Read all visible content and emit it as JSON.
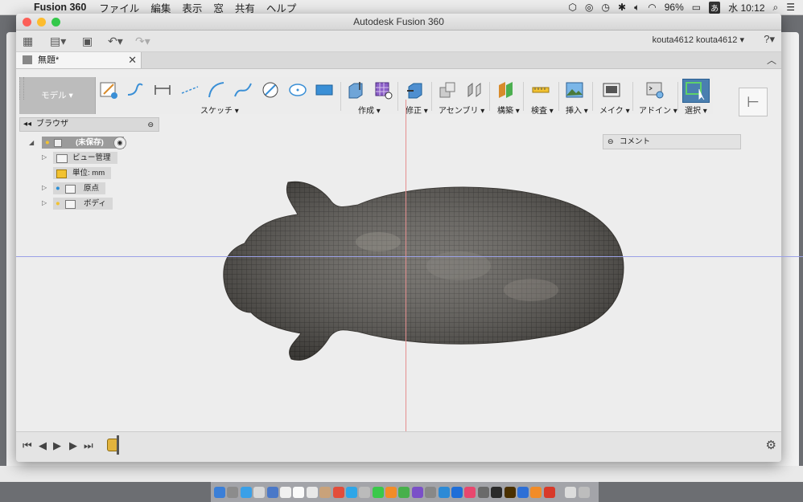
{
  "menubar": {
    "app_name": "Fusion 360",
    "items": [
      "ファイル",
      "編集",
      "表示",
      "窓",
      "共有",
      "ヘルプ"
    ],
    "battery": "96%",
    "input_mode": "あ",
    "clock": "水 10:12"
  },
  "window": {
    "title": "Autodesk Fusion 360",
    "user": "kouta4612 kouta4612",
    "doc_tab": "無題*"
  },
  "toolbar": {
    "workspace": "モデル",
    "groups": [
      {
        "label": "スケッチ"
      },
      {
        "label": "作成"
      },
      {
        "label": "修正"
      },
      {
        "label": "アセンブリ"
      },
      {
        "label": "構築"
      },
      {
        "label": "検査"
      },
      {
        "label": "挿入"
      },
      {
        "label": "メイク"
      },
      {
        "label": "アドイン"
      },
      {
        "label": "選択"
      }
    ]
  },
  "browser": {
    "title": "ブラウザ",
    "root": "(未保存)",
    "items": [
      "ビュー管理",
      "単位: mm",
      "原点",
      "ボディ"
    ]
  },
  "comment": {
    "label": "コメント"
  },
  "colors": {
    "accent": "#3a8fd6",
    "select_active": "#4a7fb0",
    "axis_red": "#e58f8f",
    "axis_blue": "#9aa0e6"
  },
  "icons": [
    "apple-icon",
    "grid-icon",
    "file-icon",
    "save-icon",
    "undo-icon",
    "redo-icon",
    "help-icon",
    "close-icon",
    "settings-icon"
  ]
}
